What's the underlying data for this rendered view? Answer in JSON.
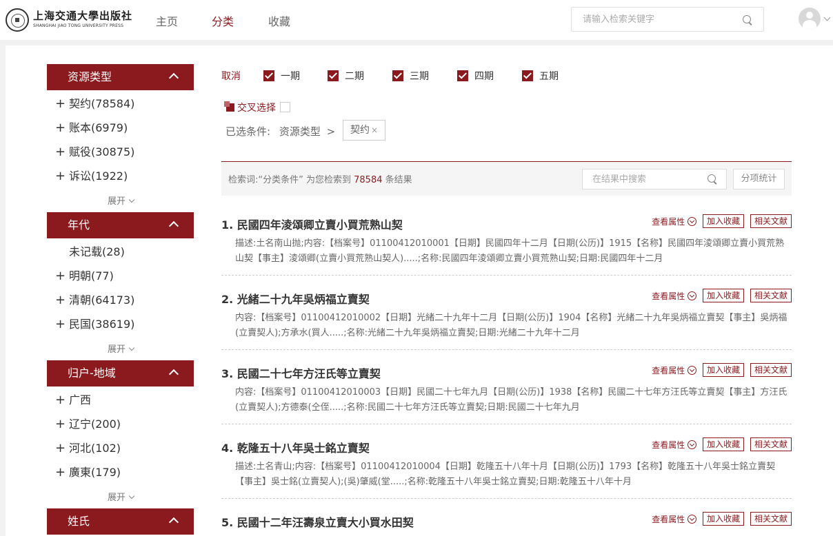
{
  "header": {
    "logo_cn": "上海交通大學出版社",
    "logo_en": "SHANGHAI JIAO TONG UNIVERSITY PRESS",
    "nav": [
      {
        "label": "主页",
        "active": false
      },
      {
        "label": "分类",
        "active": true
      },
      {
        "label": "收藏",
        "active": false
      }
    ],
    "search_placeholder": "请输入检索关键字"
  },
  "sidebar": {
    "groups": [
      {
        "title": "资源类型",
        "items": [
          "契约(78584)",
          "账本(6979)",
          "赋役(30875)",
          "诉讼(1922)"
        ],
        "expand": "展开"
      },
      {
        "title": "年代",
        "items": [
          "未记载(28)",
          "明朝(77)",
          "清朝(64173)",
          "民国(38619)"
        ],
        "expand": "展开"
      },
      {
        "title": "归户-地域",
        "items": [
          "广西",
          "辽宁(200)",
          "河北(102)",
          "廣東(179)"
        ],
        "expand": "展开"
      },
      {
        "title": "姓氏",
        "items": []
      }
    ]
  },
  "filters": {
    "cancel": "取消",
    "periods": [
      "一期",
      "二期",
      "三期",
      "四期",
      "五期"
    ],
    "cross_select": "交叉选择",
    "selected_label": "已选条件:",
    "selected_category": "资源类型",
    "selected_sep": ">",
    "selected_tag": "契约",
    "tag_remove": "×"
  },
  "results": {
    "summary_prefix": "检索词:“分类条件” 为您检索到",
    "count": "78584",
    "summary_suffix": "条结果",
    "search_placeholder": "在结果中搜索",
    "stats_button": "分项统计",
    "view_attr": "查看属性",
    "add_fav": "加入收藏",
    "related": "相关文献",
    "items": [
      {
        "title": "1. 民國四年淩頌卿立賣小買荒熟山契",
        "desc": "描述:土名南山抛;内容:【档案号】01100412010001【日期】民國四年十二月【日期(公历)】1915【名称】民國四年淩頌卿立賣小買荒熟山契【事主】淩頌卿(立賣小買荒熟山契人).....;名称:民國四年淩頌卿立賣小買荒熟山契;日期:民國四年十二月"
      },
      {
        "title": "2. 光緒二十九年吳炳福立賣契",
        "desc": "内容:【档案号】01100412010002【日期】光緒二十九年十二月【日期(公历)】1904【名称】光緒二十九年吳炳福立賣契【事主】吳炳福(立賣契人);方承水(買人.....;名称:光緒二十九年吳炳福立賣契;日期:光緒二十九年十二月"
      },
      {
        "title": "3. 民國二十七年方汪氏等立賣契",
        "desc": "内容:【档案号】01100412010003【日期】民國二十七年九月【日期(公历)】1938【名称】民國二十七年方汪氏等立賣契【事主】方汪氏(立賣契人);方德泰(仝侄.....;名称:民國二十七年方汪氏等立賣契;日期:民國二十七年九月"
      },
      {
        "title": "4. 乾隆五十八年吳士銘立賣契",
        "desc": "描述:土名青山;内容:【档案号】01100412010004【日期】乾隆五十八年十月【日期(公历)】1793【名称】乾隆五十八年吳士銘立賣契【事主】吳士銘(立賣契人);(吳)肇威(堂.....;名称:乾隆五十八年吳士銘立賣契;日期:乾隆五十八年十月"
      },
      {
        "title": "5. 民國十二年汪壽泉立賣大小買水田契",
        "desc": ""
      }
    ]
  }
}
